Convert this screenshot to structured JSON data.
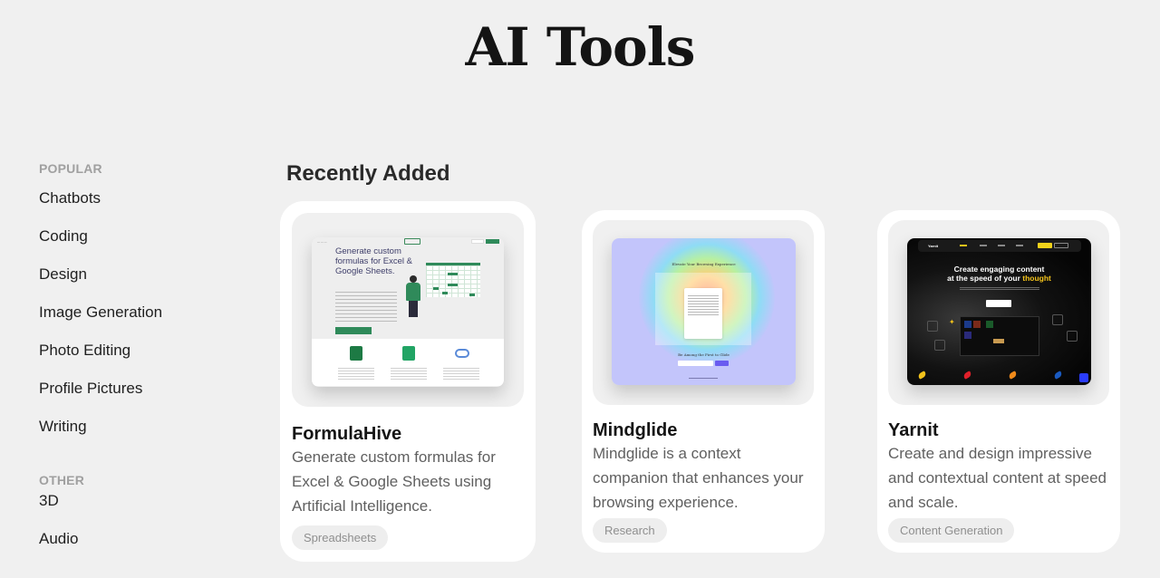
{
  "header": {
    "title": "AI Tools"
  },
  "sidebar": {
    "sections": [
      {
        "heading": "POPULAR",
        "items": [
          "Chatbots",
          "Coding",
          "Design",
          "Image Generation",
          "Photo Editing",
          "Profile Pictures",
          "Writing"
        ]
      },
      {
        "heading": "OTHER",
        "items": [
          "3D",
          "Audio"
        ]
      }
    ]
  },
  "main": {
    "section_title": "Recently Added",
    "cards": [
      {
        "name": "FormulaHive",
        "description": "Generate custom formulas for Excel & Google Sheets using Artificial Intelligence.",
        "tag": "Spreadsheets",
        "preview": {
          "headline": "Generate custom formulas for Excel & Google Sheets.",
          "accent": "#2f8a5a"
        }
      },
      {
        "name": "Mindglide",
        "description": "Mindglide is a context companion that enhances your browsing experience.",
        "tag": "Research",
        "preview": {
          "title": "Elevate Your Browsing Experience",
          "subtitle": "Be Among the First to Glide",
          "accent": "#6a5cf0"
        }
      },
      {
        "name": "Yarnit",
        "description": "Create and design impressive and contextual content at speed and scale.",
        "tag": "Content Generation",
        "preview": {
          "logo": "Yarnit",
          "headline_white_1": "Create engaging content",
          "headline_white_2": "at the speed of your ",
          "headline_yellow": "thought",
          "accent": "#f2c21b"
        }
      }
    ]
  }
}
